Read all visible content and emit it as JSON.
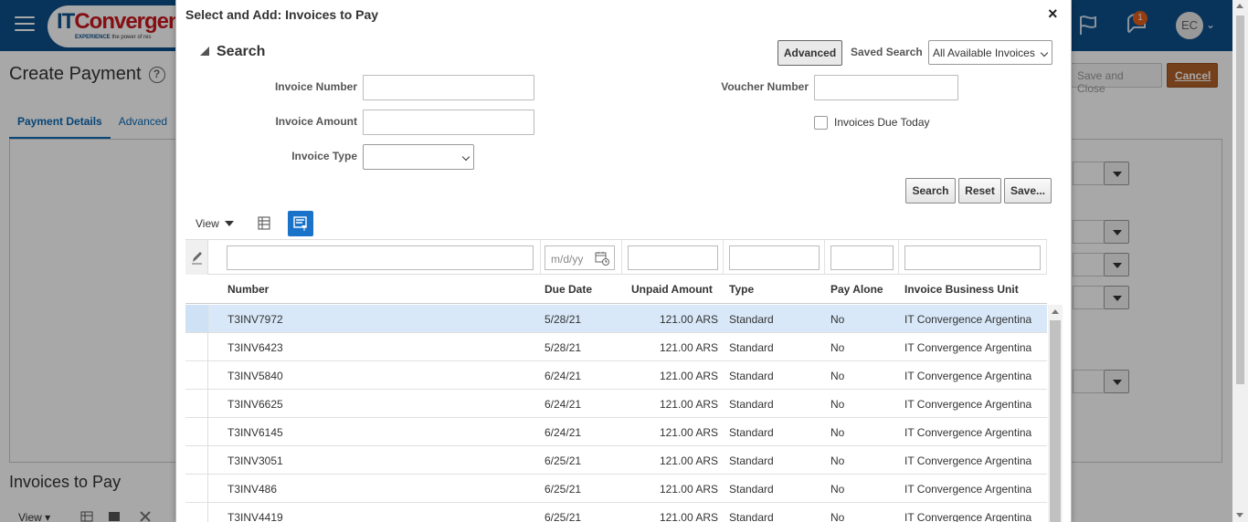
{
  "app": {
    "logo_it": "IT",
    "logo_conv": "Convergence",
    "logo_tagline_strong": "EXPERIENCE",
    "logo_tagline": " the power of res",
    "notification_count": "1",
    "user_initials": "EC"
  },
  "page": {
    "title": "Create Payment",
    "tabs": [
      "Payment Details",
      "Advanced"
    ],
    "save_and_close": "Save and Close",
    "cancel": "Cancel",
    "invoices_title": "Invoices to Pay",
    "view_label": "View"
  },
  "dialog": {
    "title": "Select and Add: Invoices to Pay",
    "close": "×",
    "search": {
      "heading": "Search",
      "advanced_label": "Advanced",
      "saved_search_label": "Saved Search",
      "saved_search_value": "All Available Invoices",
      "invoice_number_label": "Invoice Number",
      "invoice_amount_label": "Invoice Amount",
      "invoice_type_label": "Invoice Type",
      "voucher_number_label": "Voucher Number",
      "invoices_due_today_label": "Invoices Due Today",
      "search_button": "Search",
      "reset_button": "Reset",
      "save_button": "Save..."
    },
    "toolbar": {
      "view_label": "View"
    },
    "table": {
      "date_placeholder": "m/d/yy",
      "columns": [
        "Number",
        "Due Date",
        "Unpaid Amount",
        "Type",
        "Pay Alone",
        "Invoice Business Unit"
      ],
      "rows": [
        {
          "number": "T3INV7972",
          "due": "5/28/21",
          "amount": "121.00 ARS",
          "type": "Standard",
          "pay_alone": "No",
          "bu": "IT Convergence Argentina"
        },
        {
          "number": "T3INV6423",
          "due": "5/28/21",
          "amount": "121.00 ARS",
          "type": "Standard",
          "pay_alone": "No",
          "bu": "IT Convergence Argentina"
        },
        {
          "number": "T3INV5840",
          "due": "6/24/21",
          "amount": "121.00 ARS",
          "type": "Standard",
          "pay_alone": "No",
          "bu": "IT Convergence Argentina"
        },
        {
          "number": "T3INV6625",
          "due": "6/24/21",
          "amount": "121.00 ARS",
          "type": "Standard",
          "pay_alone": "No",
          "bu": "IT Convergence Argentina"
        },
        {
          "number": "T3INV6145",
          "due": "6/24/21",
          "amount": "121.00 ARS",
          "type": "Standard",
          "pay_alone": "No",
          "bu": "IT Convergence Argentina"
        },
        {
          "number": "T3INV3051",
          "due": "6/25/21",
          "amount": "121.00 ARS",
          "type": "Standard",
          "pay_alone": "No",
          "bu": "IT Convergence Argentina"
        },
        {
          "number": "T3INV486",
          "due": "6/25/21",
          "amount": "121.00 ARS",
          "type": "Standard",
          "pay_alone": "No",
          "bu": "IT Convergence Argentina"
        },
        {
          "number": "T3INV4419",
          "due": "6/25/21",
          "amount": "121.00 ARS",
          "type": "Standard",
          "pay_alone": "No",
          "bu": "IT Convergence Argentina"
        }
      ]
    }
  },
  "colors": {
    "topbar": "#0d4f8b",
    "accent": "#1a73c9",
    "cancel": "#b0602a",
    "selected_row": "#d8e8f8"
  }
}
